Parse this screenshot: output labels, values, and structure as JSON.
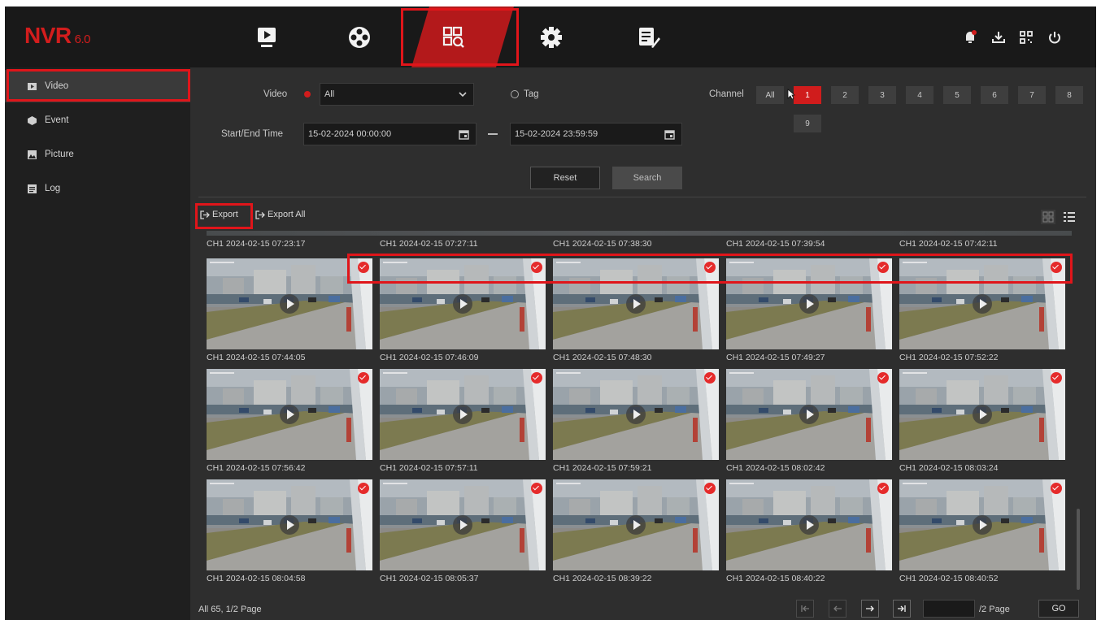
{
  "app": {
    "logo_text": "NVR",
    "logo_version": "6.0"
  },
  "colors": {
    "accent": "#d01c1c",
    "background": "#2e2e2e",
    "topbar": "#191919",
    "sidebar": "#1f1f1f",
    "highlight": "#e0151a"
  },
  "top_nav": {
    "icons": [
      "playback-icon",
      "live-view-icon",
      "search-icon",
      "settings-icon",
      "maintenance-icon"
    ],
    "active": "search-icon",
    "right_icons": [
      "alarm-icon",
      "download-icon",
      "qr-code-icon",
      "power-icon"
    ]
  },
  "sidebar": {
    "items": [
      {
        "label": "Video",
        "icon": "video-icon",
        "active": true
      },
      {
        "label": "Event",
        "icon": "event-icon",
        "active": false
      },
      {
        "label": "Picture",
        "icon": "picture-icon",
        "active": false
      },
      {
        "label": "Log",
        "icon": "log-icon",
        "active": false
      }
    ]
  },
  "filters": {
    "video_label": "Video",
    "video_value": "All",
    "tag_label": "Tag",
    "channel_label": "Channel",
    "channels": [
      "All",
      "1",
      "2",
      "3",
      "4",
      "5",
      "6",
      "7",
      "8",
      "9"
    ],
    "selected_channel": "1",
    "time_label": "Start/End Time",
    "start_time": "15-02-2024 00:00:00",
    "end_time": "15-02-2024 23:59:59",
    "reset_label": "Reset",
    "search_label": "Search"
  },
  "toolbar": {
    "export_label": "Export",
    "export_all_label": "Export All"
  },
  "results": {
    "top_partial_captions": [
      "CH1 2024-02-15 07:23:17",
      "CH1 2024-02-15 07:27:11",
      "CH1 2024-02-15 07:38:30",
      "CH1 2024-02-15 07:39:54",
      "CH1 2024-02-15 07:42:11"
    ],
    "rows": [
      [
        "CH1 2024-02-15 07:44:05",
        "CH1 2024-02-15 07:46:09",
        "CH1 2024-02-15 07:48:30",
        "CH1 2024-02-15 07:49:27",
        "CH1 2024-02-15 07:52:22"
      ],
      [
        "CH1 2024-02-15 07:56:42",
        "CH1 2024-02-15 07:57:11",
        "CH1 2024-02-15 07:59:21",
        "CH1 2024-02-15 08:02:42",
        "CH1 2024-02-15 08:03:24"
      ],
      [
        "CH1 2024-02-15 08:04:58",
        "CH1 2024-02-15 08:05:37",
        "CH1 2024-02-15 08:39:22",
        "CH1 2024-02-15 08:40:22",
        "CH1 2024-02-15 08:40:52"
      ]
    ]
  },
  "footer": {
    "summary": "All 65, 1/2 Page",
    "page_suffix": "/2 Page",
    "go_label": "GO",
    "page_input": ""
  }
}
